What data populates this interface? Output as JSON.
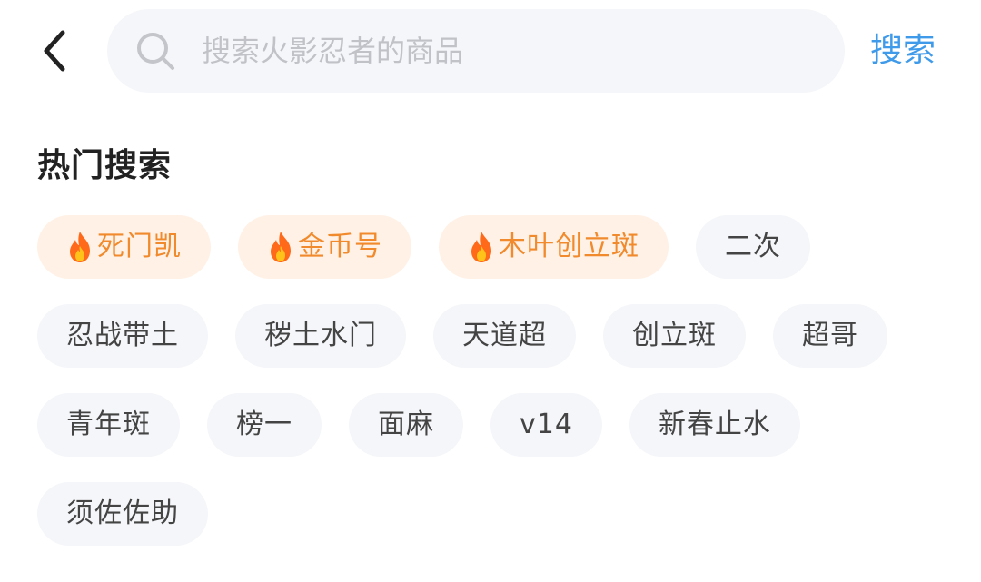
{
  "header": {
    "back_icon": "chevron-left-icon",
    "search": {
      "icon": "search-icon",
      "placeholder": "搜索火影忍者的商品",
      "value": ""
    },
    "search_button_label": "搜索",
    "accent_color": "#3f9bea"
  },
  "hot_search": {
    "title": "热门搜索",
    "hot_icon": "fire-icon",
    "hot_color": "#f08a2c",
    "rows": [
      {
        "tags": [
          {
            "label": "死门凯",
            "hot": true
          },
          {
            "label": "金币号",
            "hot": true
          },
          {
            "label": "木叶创立斑",
            "hot": true
          },
          {
            "label": "二次",
            "hot": false
          }
        ]
      },
      {
        "tags": [
          {
            "label": "忍战带土",
            "hot": false
          },
          {
            "label": "秽土水门",
            "hot": false
          },
          {
            "label": "天道超",
            "hot": false
          },
          {
            "label": "创立斑",
            "hot": false
          },
          {
            "label": "超哥",
            "hot": false
          }
        ]
      },
      {
        "tags": [
          {
            "label": "青年斑",
            "hot": false
          },
          {
            "label": "榜一",
            "hot": false
          },
          {
            "label": "面麻",
            "hot": false
          },
          {
            "label": "v14",
            "hot": false
          },
          {
            "label": "新春止水",
            "hot": false
          }
        ]
      },
      {
        "tags": [
          {
            "label": "须佐佐助",
            "hot": false
          }
        ]
      }
    ]
  }
}
